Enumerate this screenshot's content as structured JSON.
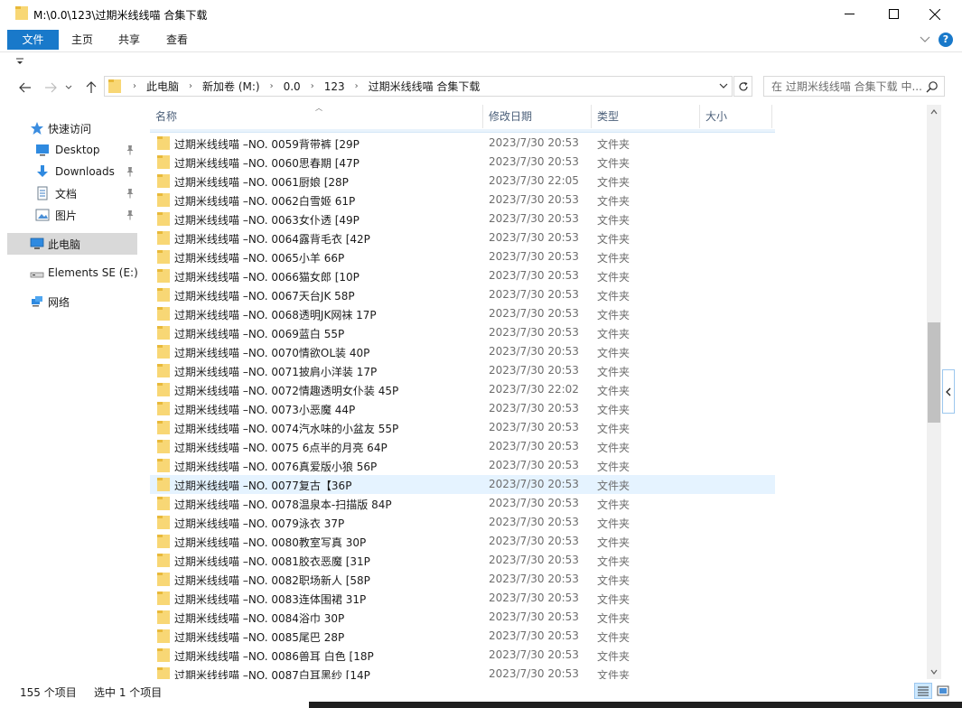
{
  "window": {
    "title": "M:\\0.0\\123\\过期米线线喵 合集下载",
    "accent_color": "#1979ca"
  },
  "ribbon": {
    "tabs": [
      "文件",
      "主页",
      "共享",
      "查看"
    ],
    "help_label": "?"
  },
  "address": {
    "crumbs": [
      "此电脑",
      "新加卷 (M:)",
      "0.0",
      "123",
      "过期米线线喵 合集下载"
    ]
  },
  "search": {
    "placeholder": "在 过期米线线喵 合集下载 中..."
  },
  "nav": {
    "items": [
      {
        "label": "快速访问",
        "icon": "star-icon"
      },
      {
        "label": "Desktop",
        "icon": "desktop-icon",
        "pinned": true
      },
      {
        "label": "Downloads",
        "icon": "download-icon",
        "pinned": true
      },
      {
        "label": "文档",
        "icon": "document-icon",
        "pinned": true
      },
      {
        "label": "图片",
        "icon": "picture-icon",
        "pinned": true
      },
      {
        "label": "此电脑",
        "icon": "computer-icon",
        "selected": true
      },
      {
        "label": "Elements SE (E:)",
        "icon": "drive-icon"
      },
      {
        "label": "网络",
        "icon": "network-icon"
      }
    ]
  },
  "columns": [
    "名称",
    "修改日期",
    "类型",
    "大小"
  ],
  "files": [
    {
      "name": "过期米线线喵 –NO. 0059背带裤 [29P",
      "date": "2023/7/30 20:53",
      "type": "文件夹"
    },
    {
      "name": "过期米线线喵 –NO. 0060思春期 [47P",
      "date": "2023/7/30 20:53",
      "type": "文件夹"
    },
    {
      "name": "过期米线线喵 –NO. 0061厨娘 [28P",
      "date": "2023/7/30 22:05",
      "type": "文件夹"
    },
    {
      "name": "过期米线线喵 –NO. 0062白雪姬 61P",
      "date": "2023/7/30 20:53",
      "type": "文件夹"
    },
    {
      "name": "过期米线线喵 –NO. 0063女仆透 [49P",
      "date": "2023/7/30 20:53",
      "type": "文件夹"
    },
    {
      "name": "过期米线线喵 –NO. 0064露背毛衣 [42P",
      "date": "2023/7/30 20:53",
      "type": "文件夹"
    },
    {
      "name": "过期米线线喵 –NO. 0065小羊 66P",
      "date": "2023/7/30 20:53",
      "type": "文件夹"
    },
    {
      "name": "过期米线线喵 –NO. 0066猫女郎 [10P",
      "date": "2023/7/30 20:53",
      "type": "文件夹"
    },
    {
      "name": "过期米线线喵 –NO. 0067天台JK 58P",
      "date": "2023/7/30 20:53",
      "type": "文件夹"
    },
    {
      "name": "过期米线线喵 –NO. 0068透明JK网袜 17P",
      "date": "2023/7/30 20:53",
      "type": "文件夹"
    },
    {
      "name": "过期米线线喵 –NO. 0069蓝白 55P",
      "date": "2023/7/30 20:53",
      "type": "文件夹"
    },
    {
      "name": "过期米线线喵 –NO. 0070情欲OL装 40P",
      "date": "2023/7/30 20:53",
      "type": "文件夹"
    },
    {
      "name": "过期米线线喵 –NO. 0071披肩小洋装 17P",
      "date": "2023/7/30 20:53",
      "type": "文件夹"
    },
    {
      "name": "过期米线线喵 –NO. 0072情趣透明女仆装 45P",
      "date": "2023/7/30 22:02",
      "type": "文件夹"
    },
    {
      "name": "过期米线线喵 –NO. 0073小恶魔 44P",
      "date": "2023/7/30 20:53",
      "type": "文件夹"
    },
    {
      "name": "过期米线线喵 –NO. 0074汽水味的小盆友 55P",
      "date": "2023/7/30 20:53",
      "type": "文件夹"
    },
    {
      "name": "过期米线线喵 –NO. 0075 6点半的月亮 64P",
      "date": "2023/7/30 20:53",
      "type": "文件夹"
    },
    {
      "name": "过期米线线喵 –NO. 0076真爱版小狼 56P",
      "date": "2023/7/30 20:53",
      "type": "文件夹"
    },
    {
      "name": "过期米线线喵 –NO. 0077复古【36P",
      "date": "2023/7/30 20:53",
      "type": "文件夹",
      "selected": true
    },
    {
      "name": "过期米线线喵 –NO. 0078温泉本-扫描版 84P",
      "date": "2023/7/30 20:53",
      "type": "文件夹"
    },
    {
      "name": "过期米线线喵 –NO. 0079泳衣 37P",
      "date": "2023/7/30 20:53",
      "type": "文件夹"
    },
    {
      "name": "过期米线线喵 –NO. 0080教室写真 30P",
      "date": "2023/7/30 20:53",
      "type": "文件夹"
    },
    {
      "name": "过期米线线喵 –NO. 0081胶衣恶魔 [31P",
      "date": "2023/7/30 20:53",
      "type": "文件夹"
    },
    {
      "name": "过期米线线喵 –NO. 0082职场新人 [58P",
      "date": "2023/7/30 20:53",
      "type": "文件夹"
    },
    {
      "name": "过期米线线喵 –NO. 0083连体围裙 31P",
      "date": "2023/7/30 20:53",
      "type": "文件夹"
    },
    {
      "name": "过期米线线喵 –NO. 0084浴巾 30P",
      "date": "2023/7/30 20:53",
      "type": "文件夹"
    },
    {
      "name": "过期米线线喵 –NO. 0085尾巴 28P",
      "date": "2023/7/30 20:53",
      "type": "文件夹"
    },
    {
      "name": "过期米线线喵 –NO. 0086兽耳 白色 [18P",
      "date": "2023/7/30 20:53",
      "type": "文件夹"
    },
    {
      "name": "过期米线线喵 –NO. 0087白耳黑纱 [14P",
      "date": "2023/7/30 20:53",
      "type": "文件夹"
    }
  ],
  "status": {
    "item_count": "155 个项目",
    "selected_count": "选中 1 个项目"
  }
}
